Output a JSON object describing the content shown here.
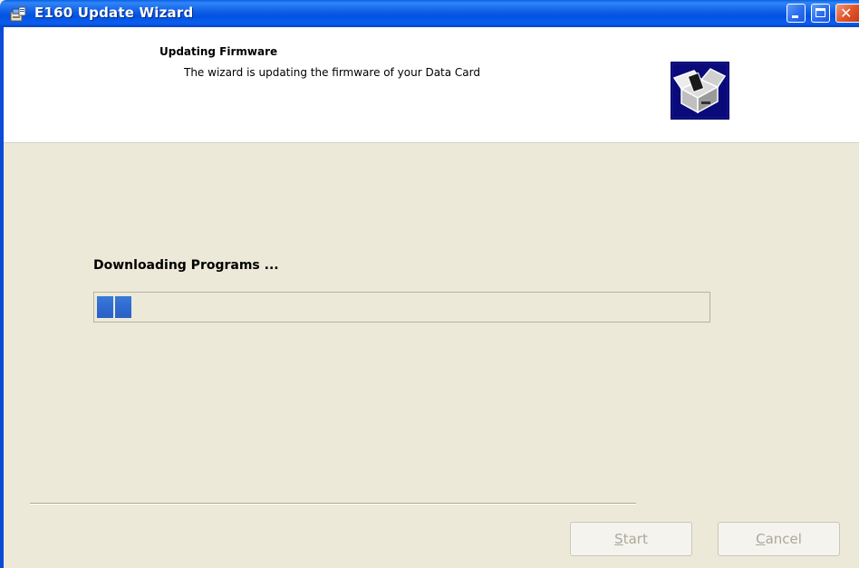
{
  "window": {
    "title": "E160 Update Wizard",
    "app_icon": "setup-wizard-icon",
    "controls": {
      "minimize_icon": "minimize-icon",
      "maximize_icon": "maximize-icon",
      "close_icon": "close-icon"
    }
  },
  "header": {
    "title": "Updating Firmware",
    "subtitle": "The wizard is updating the firmware of your Data Card",
    "icon": "firmware-box-icon"
  },
  "content": {
    "status_text": "Downloading Programs ...",
    "progress_percent": 6
  },
  "buttons": {
    "start": {
      "accel": "S",
      "rest": "tart",
      "enabled": false
    },
    "cancel": {
      "accel": "C",
      "rest": "ancel",
      "enabled": false
    }
  },
  "colors": {
    "titlebar": "#0a5fe3",
    "progress_fill": "#2f6ad0",
    "dialog_bg": "#ece9d8",
    "disabled_text": "#aca899"
  }
}
